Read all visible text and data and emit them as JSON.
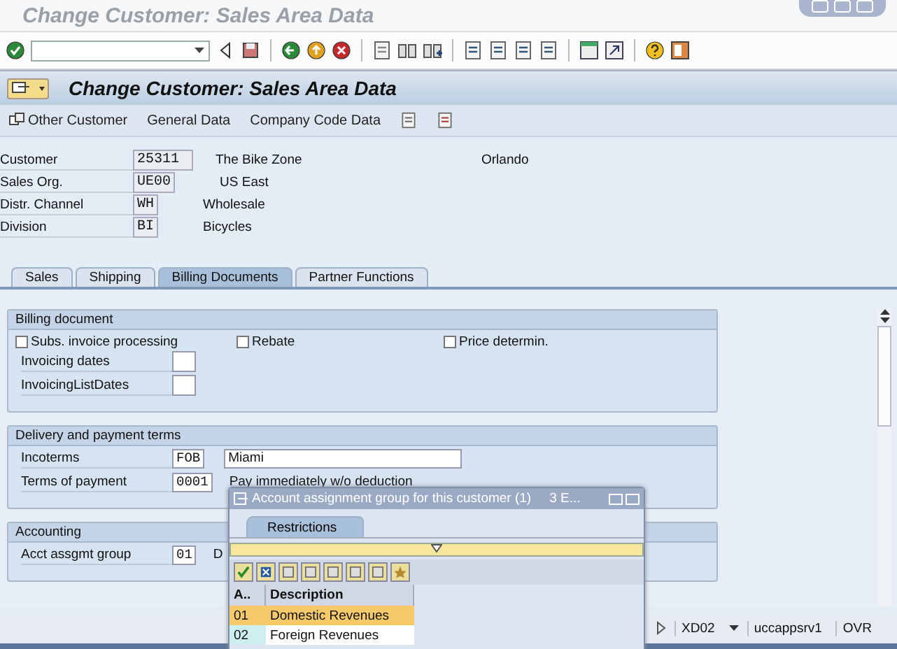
{
  "window": {
    "title": "Change Customer: Sales Area Data"
  },
  "header": {
    "title": "Change Customer: Sales Area Data"
  },
  "app_toolbar": {
    "items": [
      "Other Customer",
      "General Data",
      "Company Code Data"
    ]
  },
  "key_fields": [
    {
      "label": "Customer",
      "value": "25311",
      "description": "The Bike Zone",
      "extra": "Orlando",
      "kind": "wide"
    },
    {
      "label": "Sales Org.",
      "value": "UE00",
      "description": "US East",
      "kind": "short"
    },
    {
      "label": "Distr. Channel",
      "value": "WH",
      "description": "Wholesale",
      "kind": "short"
    },
    {
      "label": "Division",
      "value": "BI",
      "description": "Bicycles",
      "kind": "short"
    }
  ],
  "tabs": [
    {
      "label": "Sales",
      "selected": false
    },
    {
      "label": "Shipping",
      "selected": false
    },
    {
      "label": "Billing Documents",
      "selected": true
    },
    {
      "label": "Partner Functions",
      "selected": false
    }
  ],
  "billing_document": {
    "title": "Billing document",
    "checkboxes": [
      {
        "label": "Subs. invoice processing",
        "checked": false
      },
      {
        "label": "Rebate",
        "checked": false
      },
      {
        "label": "Price determin.",
        "checked": false
      }
    ],
    "fields": [
      {
        "label": "Invoicing dates"
      },
      {
        "label": "InvoicingListDates"
      }
    ]
  },
  "delivery_and_payment_terms": {
    "title": "Delivery and payment terms",
    "rows": [
      {
        "label": "Incoterms",
        "value": "FOB",
        "detail": "Miami",
        "kind": "input"
      },
      {
        "label": "Terms of payment",
        "value": "0001",
        "detail": "Pay immediately w/o deduction",
        "kind": "text"
      }
    ]
  },
  "accounting": {
    "title": "Accounting",
    "rows": [
      {
        "label": "Acct assgmt group",
        "value": "01",
        "detail": "D",
        "kind": "text"
      }
    ]
  },
  "status_bar": {
    "transaction": "XD02",
    "server": "uccappsrv1",
    "mode": "OVR"
  },
  "popup": {
    "title": "Account assignment group for this customer (1)",
    "count": "3 E...",
    "tabs": [
      {
        "label": "Restrictions",
        "selected": true
      }
    ],
    "columns": [
      "A..",
      "Description"
    ],
    "rows": [
      {
        "code": "01",
        "description": "Domestic Revenues",
        "selected": true
      },
      {
        "code": "02",
        "description": "Foreign Revenues",
        "selected": false
      }
    ]
  }
}
